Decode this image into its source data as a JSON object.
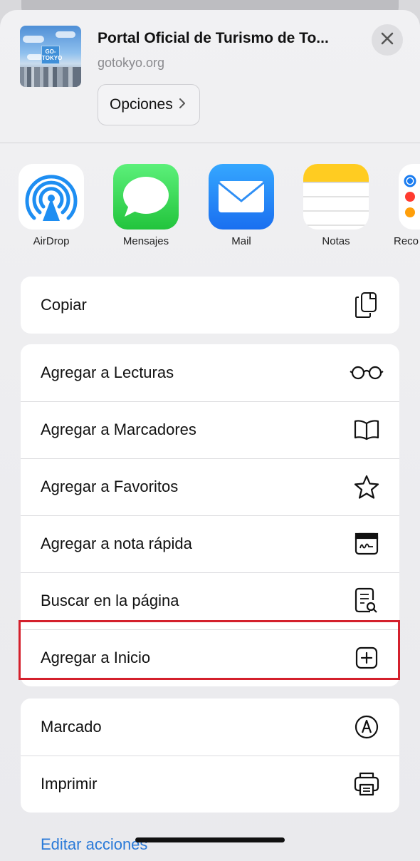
{
  "header": {
    "title": "Portal Oficial de Turismo de To...",
    "url": "gotokyo.org",
    "options_label": "Opciones",
    "thumbnail_logo": "GO-TOKYO"
  },
  "apps": [
    {
      "label": "AirDrop",
      "icon": "airdrop-icon"
    },
    {
      "label": "Mensajes",
      "icon": "messages-icon"
    },
    {
      "label": "Mail",
      "icon": "mail-icon"
    },
    {
      "label": "Notas",
      "icon": "notes-icon"
    },
    {
      "label": "Reco",
      "icon": "reminders-icon"
    }
  ],
  "group1": [
    {
      "label": "Copiar",
      "icon": "copy-icon"
    }
  ],
  "group2": [
    {
      "label": "Agregar a Lecturas",
      "icon": "glasses-icon"
    },
    {
      "label": "Agregar a Marcadores",
      "icon": "book-icon"
    },
    {
      "label": "Agregar a Favoritos",
      "icon": "star-icon"
    },
    {
      "label": "Agregar a nota rápida",
      "icon": "quick-note-icon"
    },
    {
      "label": "Buscar en la página",
      "icon": "find-in-page-icon"
    },
    {
      "label": "Agregar a Inicio",
      "icon": "add-square-icon"
    }
  ],
  "group3": [
    {
      "label": "Marcado",
      "icon": "markup-icon"
    },
    {
      "label": "Imprimir",
      "icon": "printer-icon"
    }
  ],
  "footer": {
    "edit_actions": "Editar acciones"
  },
  "colors": {
    "highlight": "#d4202c",
    "link": "#2a7ad8"
  }
}
